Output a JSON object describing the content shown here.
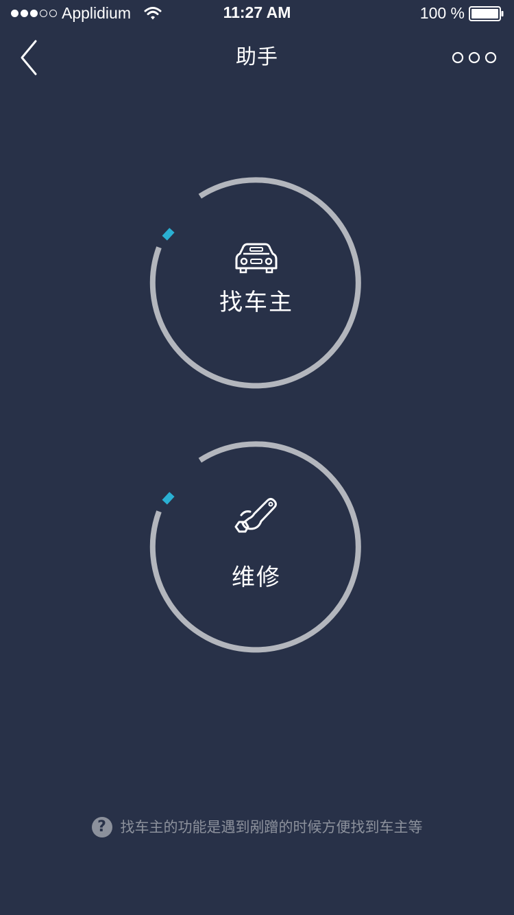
{
  "status_bar": {
    "carrier": "Applidium",
    "time": "11:27 AM",
    "battery": "100 %",
    "signal_bars_filled": 3,
    "signal_bars_total": 5
  },
  "nav": {
    "title": "助手",
    "back_icon": "chevron-left-icon",
    "more_icon": "more-dots-icon"
  },
  "actions": [
    {
      "label": "找车主",
      "icon": "car-icon"
    },
    {
      "label": "维修",
      "icon": "wrench-icon"
    }
  ],
  "help": {
    "icon_glyph": "?",
    "text": "找车主的功能是遇到剐蹭的时候方便找到车主等"
  },
  "colors": {
    "background": "#283148",
    "ring": "#b3b6bd",
    "accent": "#2ab0d3",
    "muted_text": "#8c919c"
  }
}
